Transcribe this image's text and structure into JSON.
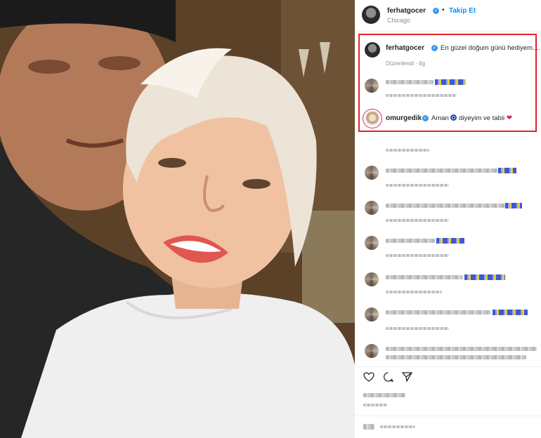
{
  "post": {
    "author": "ferhatgocer",
    "follow_label": "Takip Et",
    "separator": "•",
    "location": "Chicago"
  },
  "caption": {
    "author": "ferhatgocer",
    "text": "En güzel doğum günü hediyem....",
    "meta": "Düzenlendi · 6g"
  },
  "highlight_comment": {
    "author": "omurgedik",
    "text_before": "Aman",
    "text_after": "diyeyim ve tabii",
    "emoji_icons": [
      "nazar-boncugu-icon",
      "red-heart-icon"
    ]
  },
  "colors": {
    "highlight_border": "#e32228",
    "link_blue": "#0095f6",
    "verified_blue": "#3897f0",
    "muted": "#8e8e8e"
  },
  "icons": [
    "verified-badge-icon",
    "heart-outline-icon",
    "comment-icon",
    "share-icon"
  ]
}
